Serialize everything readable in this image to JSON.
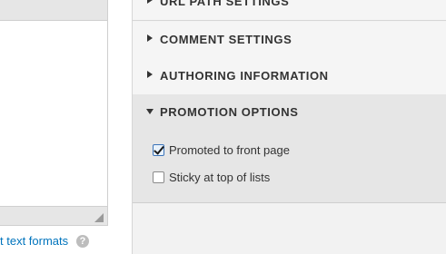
{
  "editor": {
    "formats_link": "t text formats",
    "help_icon": "?"
  },
  "sidebar": {
    "sections": [
      {
        "label": "URL PATH SETTINGS",
        "expanded": false
      },
      {
        "label": "COMMENT SETTINGS",
        "expanded": false
      },
      {
        "label": "AUTHORING INFORMATION",
        "expanded": false
      },
      {
        "label": "PROMOTION OPTIONS",
        "expanded": true
      }
    ],
    "promotion": {
      "promoted_label": "Promoted to front page",
      "promoted_checked": true,
      "sticky_label": "Sticky at top of lists",
      "sticky_checked": false
    }
  }
}
